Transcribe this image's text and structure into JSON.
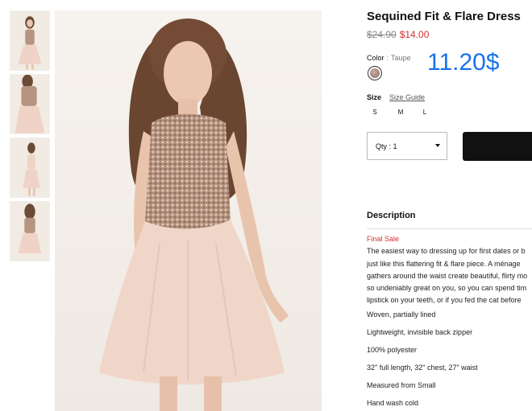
{
  "product": {
    "title": "Sequined Fit & Flare Dress",
    "original_price": "$24.90",
    "sale_price": "$14.00",
    "display_price": "11.20$",
    "color_label": "Color",
    "color_value": "Taupe",
    "size_label": "Size",
    "size_guide_label": "Size Guide",
    "sizes": [
      "S",
      "M",
      "L"
    ],
    "quantity_label": "Qty : 1"
  },
  "description": {
    "title": "Description",
    "final_sale": "Final Sale",
    "lines": [
      "The easiest way to dressing up for first dates or b",
      "just like this flattering fit & flare piece. A ménage",
      "gathers around the waist create beautiful, flirty mo",
      "so undeniably great on you, so you can spend tim",
      "lipstick on your teeth, or if you fed the cat before"
    ],
    "bullets": [
      "Woven, partially lined",
      "Lightweight, invisible back zipper",
      "100% polyester",
      "32\" full length, 32\" chest, 27\" waist",
      "Measured from Small",
      "Hand wash cold"
    ]
  },
  "colors": {
    "sale_red": "#d0312d",
    "price_blue": "#1a73e8",
    "button_black": "#111111",
    "swatch_taupe": "#a8897f"
  }
}
